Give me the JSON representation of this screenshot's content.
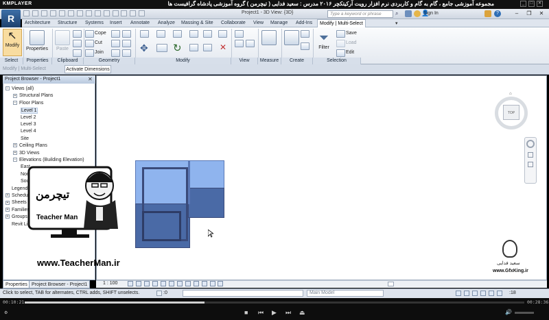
{
  "player": {
    "brand": "KMPLAYER",
    "title": "مجموعه آموزشی جامع ، گام به گام و کاربردی نرم افزار رویت آرکیتکچر ۲۰۱۶ مدرس : سعید فدایی ( تیچرمن ) گروه آموزشی پادشاه گرافیست ها",
    "time_elapsed": "00:10:21",
    "time_total": "00:28:36",
    "progress": 0.36
  },
  "revit": {
    "app_button": "R",
    "doc_title": "Project1 - 3D View: {3D}",
    "search_placeholder": "Type a keyword or phrase",
    "sign_in": "Sign In",
    "tabs": [
      "Architecture",
      "Structure",
      "Systems",
      "Insert",
      "Annotate",
      "Analyze",
      "Massing & Site",
      "Collaborate",
      "View",
      "Manage",
      "Add-Ins",
      "Modify | Multi-Select"
    ],
    "active_tab": "Modify | Multi-Select",
    "ribbon": {
      "modify_label": "Modify",
      "properties_label": "Properties",
      "paste_label": "Paste",
      "geometry_items": [
        "Cope",
        "Cut",
        "Join"
      ],
      "filter_label": "Filter",
      "selection_items": [
        "Save",
        "Load",
        "Edit"
      ],
      "panels": [
        "Select",
        "Properties",
        "Clipboard",
        "Geometry",
        "Modify",
        "View",
        "Measure",
        "Create",
        "Selection"
      ]
    },
    "options_bar": {
      "context": "Modify | Multi-Select",
      "activate_button": "Activate Dimensions"
    },
    "project_browser": {
      "title": "Project Browser - Project1",
      "close": "✕",
      "nodes": [
        {
          "label": "Views (all)",
          "toggle": "−",
          "indent": 0
        },
        {
          "label": "Structural Plans",
          "toggle": "+",
          "indent": 1
        },
        {
          "label": "Floor Plans",
          "toggle": "−",
          "indent": 1
        },
        {
          "label": "Level 1",
          "toggle": "",
          "indent": 2,
          "selected": true
        },
        {
          "label": "Level 2",
          "toggle": "",
          "indent": 2
        },
        {
          "label": "Level 3",
          "toggle": "",
          "indent": 2
        },
        {
          "label": "Level 4",
          "toggle": "",
          "indent": 2
        },
        {
          "label": "Site",
          "toggle": "",
          "indent": 2
        },
        {
          "label": "Ceiling Plans",
          "toggle": "+",
          "indent": 1
        },
        {
          "label": "3D Views",
          "toggle": "+",
          "indent": 1
        },
        {
          "label": "Elevations (Building Elevation)",
          "toggle": "−",
          "indent": 1
        },
        {
          "label": "East",
          "toggle": "",
          "indent": 2
        },
        {
          "label": "North",
          "toggle": "",
          "indent": 2
        },
        {
          "label": "South",
          "toggle": "",
          "indent": 2
        },
        {
          "label": "Legends",
          "toggle": "",
          "indent": 0
        },
        {
          "label": "Schedules/Quantities",
          "toggle": "+",
          "indent": 0
        },
        {
          "label": "Sheets (all)",
          "toggle": "+",
          "indent": 0
        },
        {
          "label": "Families",
          "toggle": "+",
          "indent": 0
        },
        {
          "label": "Groups",
          "toggle": "+",
          "indent": 0
        },
        {
          "label": "Revit Links",
          "toggle": "",
          "indent": 0
        }
      ],
      "bottom_tabs": [
        "Properties",
        "Project Browser - Project1"
      ]
    },
    "view": {
      "scale": "1 : 100",
      "viewcube_face": "TOP"
    },
    "status_bar": {
      "message": "Click to select, TAB for alternates, CTRL adds, SHIFT unselects.",
      "counter": ":0",
      "workset": "Main Model",
      "filter_count": ":18"
    }
  },
  "watermark": {
    "teacher_name": "Teacher Man",
    "teacher_brand": "تیچرمن",
    "teacher_site": "www.TeacherMan.ir",
    "author": "سعید فدایی",
    "site": "www.GfxKing.ir"
  },
  "colors": {
    "room_light": "#8fb4ee",
    "room_dark": "#4a6aa6",
    "room_border": "#3a4a7a"
  }
}
